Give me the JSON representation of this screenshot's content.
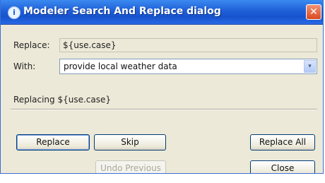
{
  "window": {
    "title": "Modeler Search And Replace dialog",
    "title_icon": "info-icon",
    "close_glyph": "✕"
  },
  "form": {
    "replace_label": "Replace:",
    "replace_value": "${use.case}",
    "with_label": "With:",
    "with_value": "provide local weather data",
    "dropdown_glyph": "▾"
  },
  "status": {
    "text": "Replacing ${use.case}"
  },
  "buttons": {
    "replace": "Replace",
    "skip": "Skip",
    "replace_all": "Replace All",
    "undo_previous": "Undo Previous",
    "close": "Close"
  },
  "colors": {
    "title_bar": "#1f5fd7",
    "dialog_bg": "#ece9d8",
    "close_button": "#d9491f"
  }
}
